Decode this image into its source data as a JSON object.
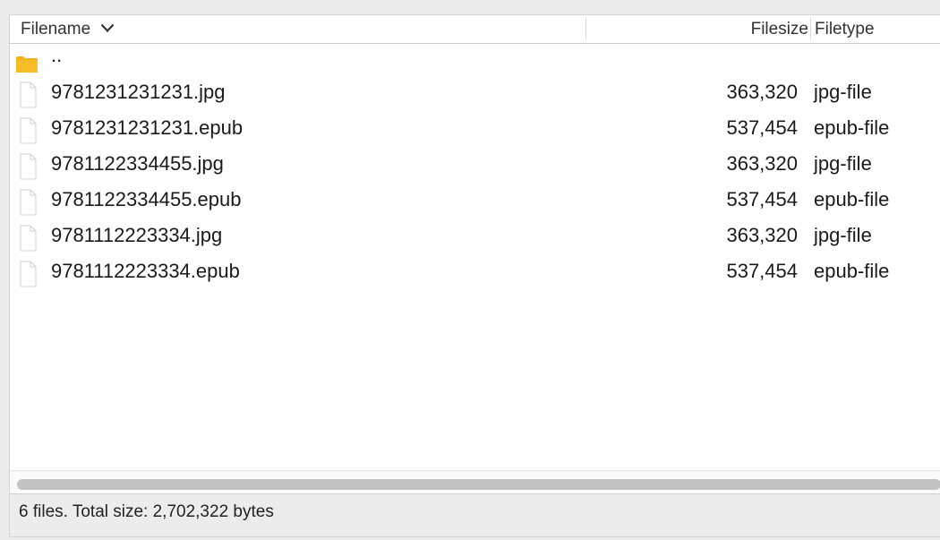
{
  "columns": {
    "filename": "Filename",
    "filesize": "Filesize",
    "filetype": "Filetype"
  },
  "parent_dir": "..",
  "files": [
    {
      "name": "9781231231231.jpg",
      "size": "363,320",
      "type": "jpg-file"
    },
    {
      "name": "9781231231231.epub",
      "size": "537,454",
      "type": "epub-file"
    },
    {
      "name": "9781122334455.jpg",
      "size": "363,320",
      "type": "jpg-file"
    },
    {
      "name": "9781122334455.epub",
      "size": "537,454",
      "type": "epub-file"
    },
    {
      "name": "9781112223334.jpg",
      "size": "363,320",
      "type": "jpg-file"
    },
    {
      "name": "9781112223334.epub",
      "size": "537,454",
      "type": "epub-file"
    }
  ],
  "status": "6 files. Total size: 2,702,322 bytes",
  "icons": {
    "sort": "chevron-down-icon",
    "parent": "folder-icon",
    "file": "file-icon"
  },
  "colors": {
    "folder": "#f3b41b"
  }
}
